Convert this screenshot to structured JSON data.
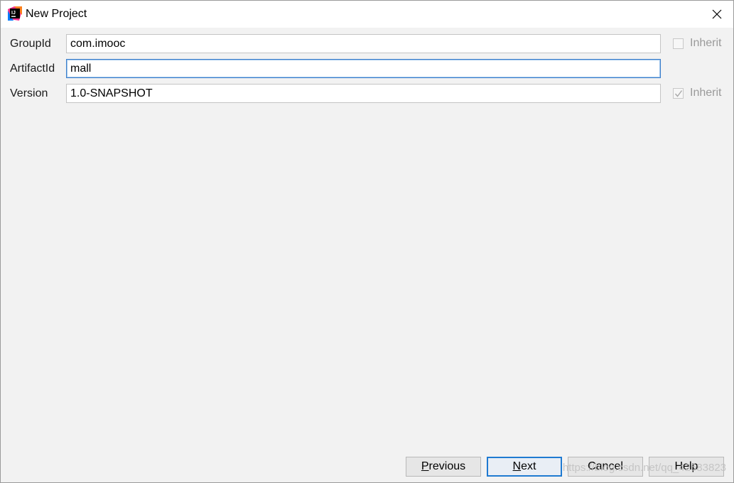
{
  "window": {
    "title": "New Project"
  },
  "form": {
    "groupId": {
      "label": "GroupId",
      "value": "com.imooc",
      "inherit_label": "Inherit",
      "inherit_checked": false
    },
    "artifactId": {
      "label": "ArtifactId",
      "value": "mall"
    },
    "version": {
      "label": "Version",
      "value": "1.0-SNAPSHOT",
      "inherit_label": "Inherit",
      "inherit_checked": true
    }
  },
  "buttons": {
    "previous": {
      "mnemonic": "P",
      "rest": "revious"
    },
    "next": {
      "mnemonic": "N",
      "rest": "ext"
    },
    "cancel": {
      "label": "Cancel"
    },
    "help": {
      "label": "Help"
    }
  },
  "watermark": "https://blog.csdn.net/qq_42683823",
  "colors": {
    "focus_border": "#3d7fcb",
    "default_button_border": "#1f7ad1",
    "background": "#f2f2f2"
  }
}
